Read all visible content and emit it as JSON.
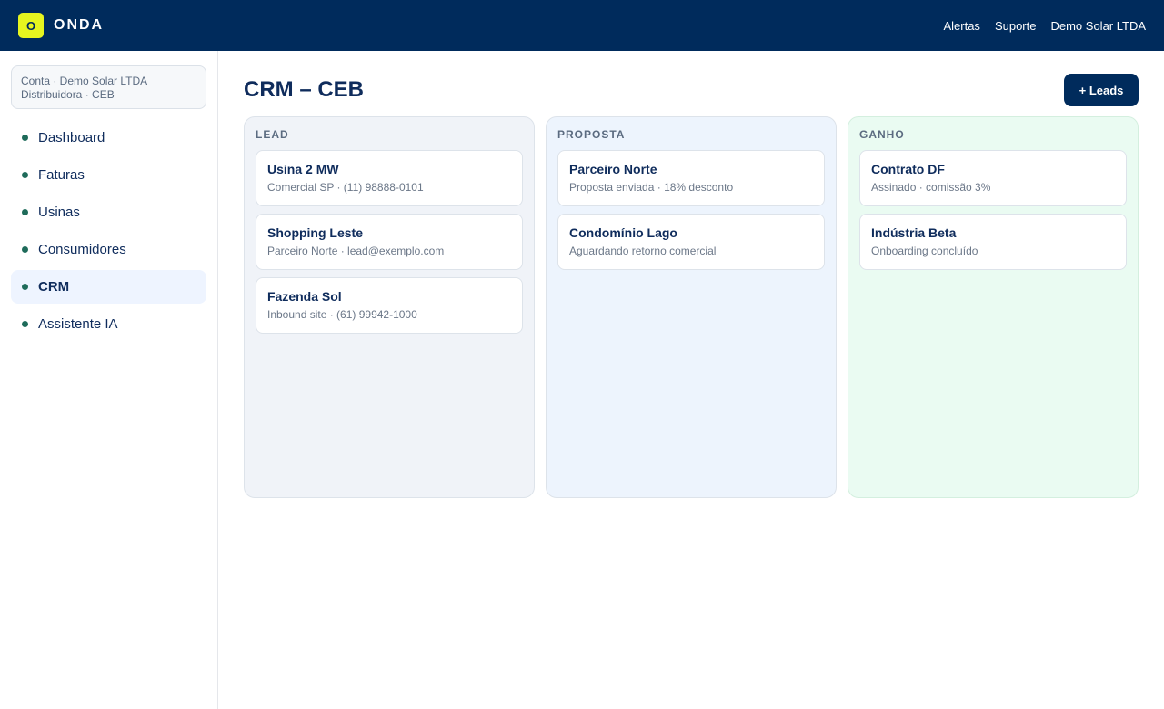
{
  "app": {
    "logo_letter": "O",
    "brand": "ONDA"
  },
  "topnav": {
    "links": [
      "Alertas",
      "Suporte",
      "Demo Solar LTDA"
    ]
  },
  "sidebar": {
    "account_line1": "Conta · Demo Solar LTDA",
    "account_line2": "Distribuidora · CEB",
    "items": [
      {
        "label": "Dashboard",
        "active": false
      },
      {
        "label": "Faturas",
        "active": false
      },
      {
        "label": "Usinas",
        "active": false
      },
      {
        "label": "Consumidores",
        "active": false
      },
      {
        "label": "CRM",
        "active": true
      },
      {
        "label": "Assistente IA",
        "active": false
      }
    ]
  },
  "main": {
    "title": "CRM – CEB",
    "add_button": "+ Leads",
    "columns": [
      {
        "title": "LEAD",
        "cards": [
          {
            "title": "Usina 2 MW",
            "subtitle": "Comercial SP · (11) 98888-0101"
          },
          {
            "title": "Shopping Leste",
            "subtitle": "Parceiro Norte · lead@exemplo.com"
          },
          {
            "title": "Fazenda Sol",
            "subtitle": "Inbound site · (61) 99942-1000"
          }
        ]
      },
      {
        "title": "PROPOSTA",
        "cards": [
          {
            "title": "Parceiro Norte",
            "subtitle": "Proposta enviada · 18% desconto"
          },
          {
            "title": "Condomínio Lago",
            "subtitle": "Aguardando retorno comercial"
          }
        ]
      },
      {
        "title": "GANHO",
        "cards": [
          {
            "title": "Contrato DF",
            "subtitle": "Assinado · comissão 3%"
          },
          {
            "title": "Indústria Beta",
            "subtitle": "Onboarding concluído"
          }
        ]
      }
    ]
  },
  "colors": {
    "topbar": "#002b5c",
    "logo": "#e6f51f",
    "nav_dot": "#1e6b5a",
    "active_nav_bg": "#eef4ff"
  }
}
